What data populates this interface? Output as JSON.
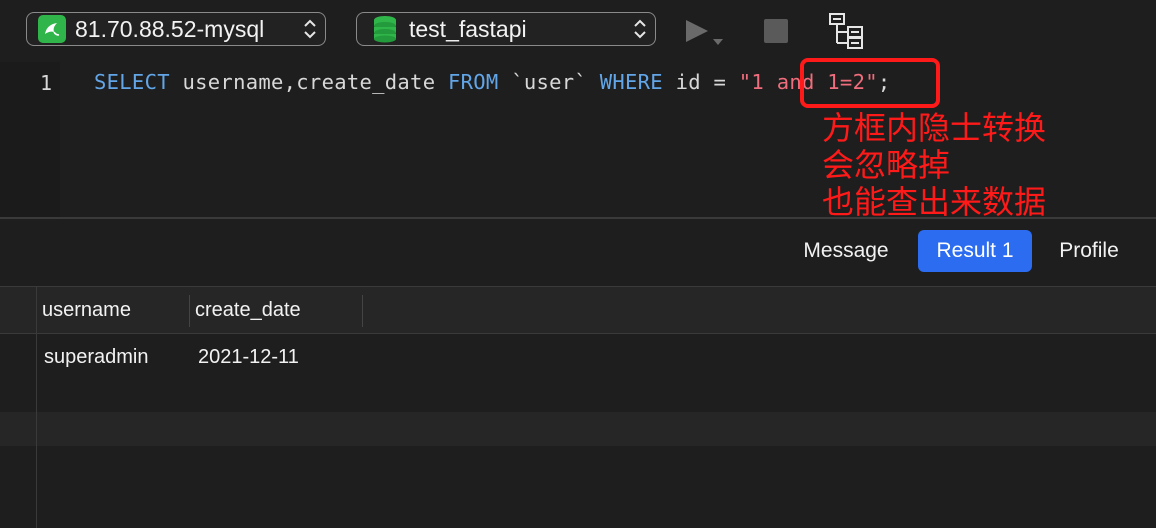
{
  "toolbar": {
    "connection": "81.70.88.52-mysql",
    "database": "test_fastapi"
  },
  "editor": {
    "line_number": "1",
    "tokens": {
      "t1": "SELECT",
      "t2": " username,create_date ",
      "t3": "FROM",
      "t4": " `user` ",
      "t5": "WHERE",
      "t6": " id = ",
      "t7": "\"1",
      "t8": " and 1=2\"",
      "t9": ";"
    }
  },
  "annotation": {
    "lines": [
      "方框内隐士转换",
      "会忽略掉",
      "也能查出来数据"
    ],
    "color": "#ff1a1a"
  },
  "tabs": {
    "message": "Message",
    "result": "Result 1",
    "profile": "Profile"
  },
  "grid": {
    "columns": [
      "username",
      "create_date"
    ],
    "rows": [
      [
        "superadmin",
        "2021-12-11"
      ]
    ]
  },
  "colors": {
    "keyword": "#62a6e8",
    "string": "#ef6d7c",
    "accent": "#2b6cf0",
    "connection_icon": "#2fb54a"
  }
}
